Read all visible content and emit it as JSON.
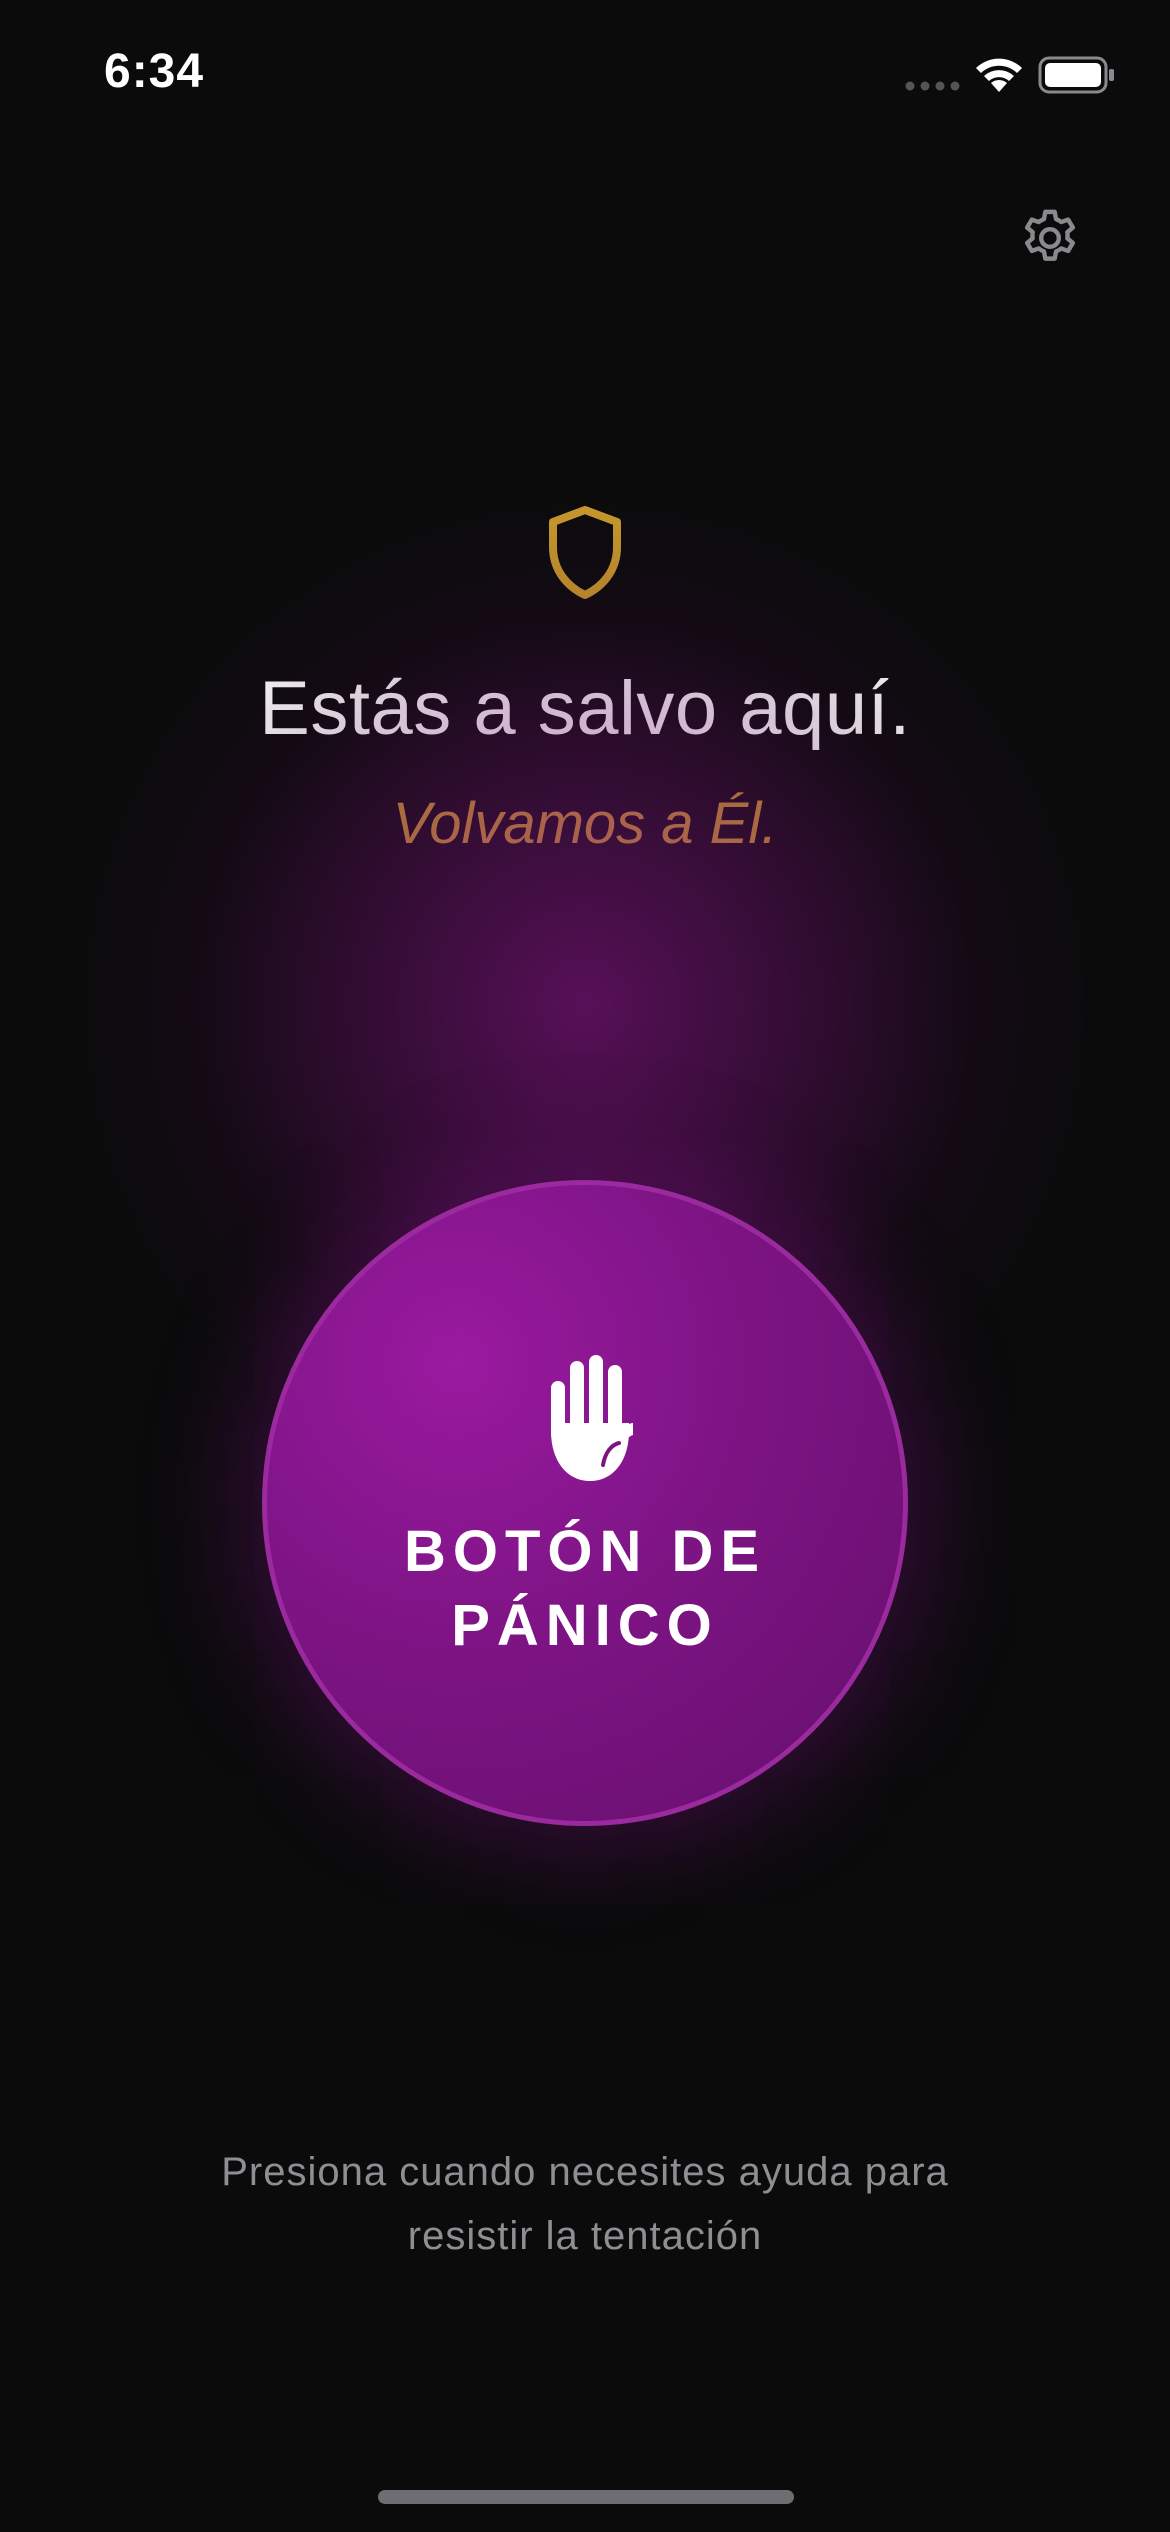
{
  "status_bar": {
    "time": "6:34",
    "wifi_icon": "wifi-icon",
    "battery_icon": "battery-icon",
    "signal_icon": "signal-dots-icon"
  },
  "header": {
    "settings_icon": "gear-icon"
  },
  "hero": {
    "icon": "shield-icon",
    "title": "Estás a salvo aquí.",
    "subtitle": "Volvamos a Él."
  },
  "panic_button": {
    "icon": "raised-hand-icon",
    "label_line1": "BOTÓN DE",
    "label_line2": "PÁNICO"
  },
  "helper": {
    "line1": "Presiona cuando necesites ayuda para",
    "line2": "resistir la tentación"
  },
  "colors": {
    "background": "#0b0b0c",
    "accent_gold": "#c9992b",
    "panic_purple": "#7d1484",
    "helper_gray": "#8e8e93"
  }
}
